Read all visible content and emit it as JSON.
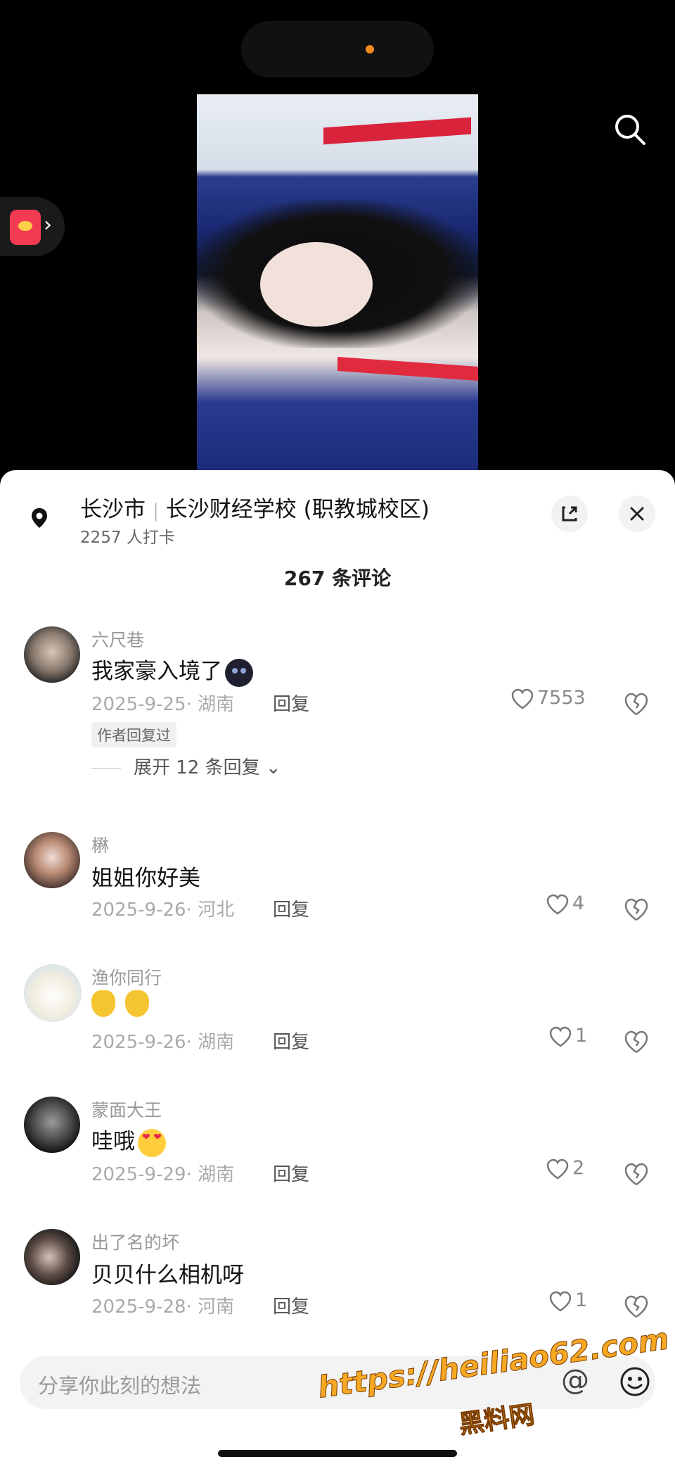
{
  "location": {
    "city": "长沙市",
    "place": "长沙财经学校 (职教城校区)",
    "checkins": "2257 人打卡"
  },
  "comments_header": "267 条评论",
  "comments": [
    {
      "user": "六尺巷",
      "text": "我家豪入境了",
      "date_loc": "2025-9-25· 湖南",
      "reply": "回复",
      "likes": "7553",
      "tag": "作者回复过",
      "expand": "展开 12 条回复"
    },
    {
      "user": "楙",
      "text": "姐姐你好美",
      "date_loc": "2025-9-26· 河北",
      "reply": "回复",
      "likes": "4"
    },
    {
      "user": "渔你同行",
      "text": "",
      "date_loc": "2025-9-26· 湖南",
      "reply": "回复",
      "likes": "1"
    },
    {
      "user": "蒙面大王",
      "text": "哇哦",
      "date_loc": "2025-9-29· 湖南",
      "reply": "回复",
      "likes": "2"
    },
    {
      "user": "出了名的坏",
      "text": "贝贝什么相机呀",
      "date_loc": "2025-9-28· 河南",
      "reply": "回复",
      "likes": "1"
    }
  ],
  "input": {
    "placeholder": "分享你此刻的想法"
  },
  "watermark": {
    "url": "https://heiliao62.com",
    "name": "黑料网"
  },
  "colors": {
    "background": "#000000",
    "sheet": "#ffffff",
    "muted_text": "#999999",
    "watermark": "#f7a823"
  },
  "icons": [
    "search-icon",
    "red-packet-icon",
    "location-pin-icon",
    "expand-icon",
    "close-icon",
    "heart-icon",
    "dislike-icon",
    "at-icon",
    "emoji-icon"
  ]
}
